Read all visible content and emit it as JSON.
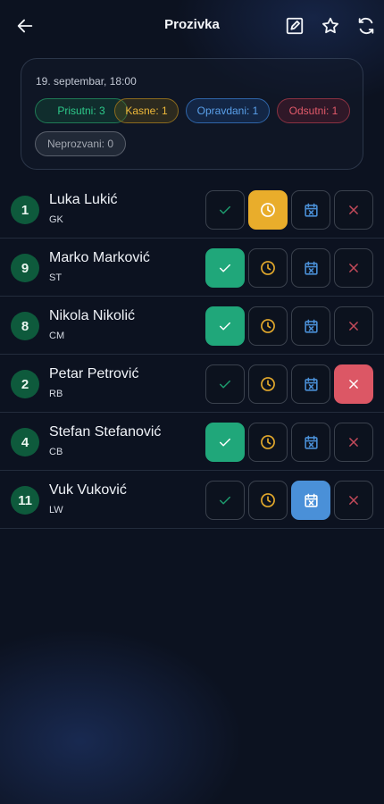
{
  "header": {
    "title": "Prozivka"
  },
  "summary": {
    "date": "19. septembar, 18:00",
    "chips": {
      "present": "Prisutni: 3",
      "late": "Kasne: 1",
      "excused": "Opravdani: 1",
      "absent": "Odsutni: 1",
      "unmarked": "Neprozvani: 0"
    }
  },
  "colors": {
    "present": "#20a77a",
    "late": "#e9ad2b",
    "excused": "#4a90d8",
    "absent": "#dc5765",
    "number_badge": "#0e5a3c"
  },
  "icons": {
    "back": "arrow-left-icon",
    "edit": "edit-note-icon",
    "favorite": "star-icon",
    "refresh": "sync-icon",
    "present": "check-icon",
    "late": "clock-icon",
    "excused": "calendar-x-icon",
    "absent": "close-icon"
  },
  "players": [
    {
      "number": "1",
      "name": "Luka Lukić",
      "position": "GK",
      "status": "late"
    },
    {
      "number": "9",
      "name": "Marko Marković",
      "position": "ST",
      "status": "present"
    },
    {
      "number": "8",
      "name": "Nikola Nikolić",
      "position": "CM",
      "status": "present"
    },
    {
      "number": "2",
      "name": "Petar Petrović",
      "position": "RB",
      "status": "absent"
    },
    {
      "number": "4",
      "name": "Stefan Stefanović",
      "position": "CB",
      "status": "present"
    },
    {
      "number": "11",
      "name": "Vuk Vuković",
      "position": "LW",
      "status": "excused"
    }
  ]
}
